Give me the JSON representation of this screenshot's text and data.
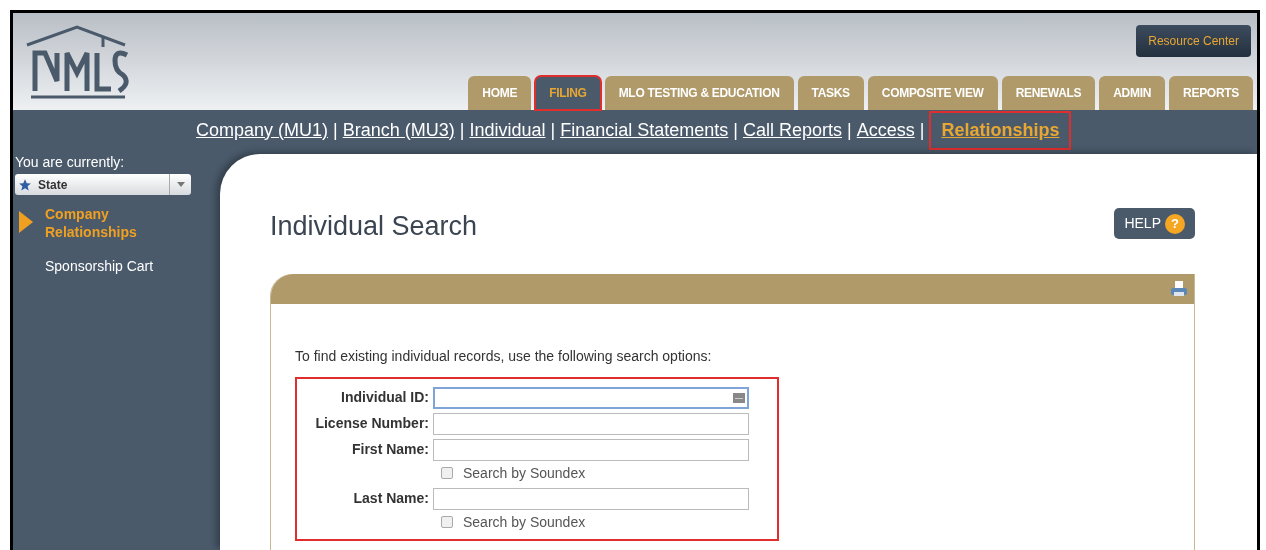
{
  "header": {
    "resource_button": "Resource Center"
  },
  "tabs": [
    {
      "label": "HOME",
      "selected": false,
      "highlighted": false
    },
    {
      "label": "FILING",
      "selected": true,
      "highlighted": true
    },
    {
      "label": "MLO TESTING & EDUCATION",
      "selected": false,
      "highlighted": false
    },
    {
      "label": "TASKS",
      "selected": false,
      "highlighted": false
    },
    {
      "label": "COMPOSITE VIEW",
      "selected": false,
      "highlighted": false
    },
    {
      "label": "RENEWALS",
      "selected": false,
      "highlighted": false
    },
    {
      "label": "ADMIN",
      "selected": false,
      "highlighted": false
    },
    {
      "label": "REPORTS",
      "selected": false,
      "highlighted": false
    }
  ],
  "subnav": [
    {
      "label": "Company (MU1)",
      "selected": false,
      "highlighted": false
    },
    {
      "label": "Branch (MU3)",
      "selected": false,
      "highlighted": false
    },
    {
      "label": "Individual",
      "selected": false,
      "highlighted": false
    },
    {
      "label": "Financial Statements",
      "selected": false,
      "highlighted": false
    },
    {
      "label": "Call Reports",
      "selected": false,
      "highlighted": false
    },
    {
      "label": "Access",
      "selected": false,
      "highlighted": false
    },
    {
      "label": "Relationships",
      "selected": true,
      "highlighted": true
    }
  ],
  "subnav_separator": "|",
  "sidebar": {
    "context_label": "You are currently:",
    "context_value": "State",
    "items": [
      {
        "label": "Company Relationships",
        "selected": true
      },
      {
        "label": "Sponsorship Cart",
        "selected": false
      }
    ]
  },
  "page_title": "Individual Search",
  "help_button": "HELP",
  "help_badge": "?",
  "panel": {
    "intro": "To find existing individual records, use the following search options:",
    "highlighted": true,
    "fields": [
      {
        "label": "Individual ID:",
        "focused": true,
        "has_soundex": false
      },
      {
        "label": "License Number:",
        "focused": false,
        "has_soundex": false
      },
      {
        "label": "First Name:",
        "focused": false,
        "has_soundex": true,
        "soundex_label": "Search by Soundex",
        "soundex_checked": false
      },
      {
        "label": "Last Name:",
        "focused": false,
        "has_soundex": true,
        "soundex_label": "Search by Soundex",
        "soundex_checked": false
      }
    ]
  }
}
